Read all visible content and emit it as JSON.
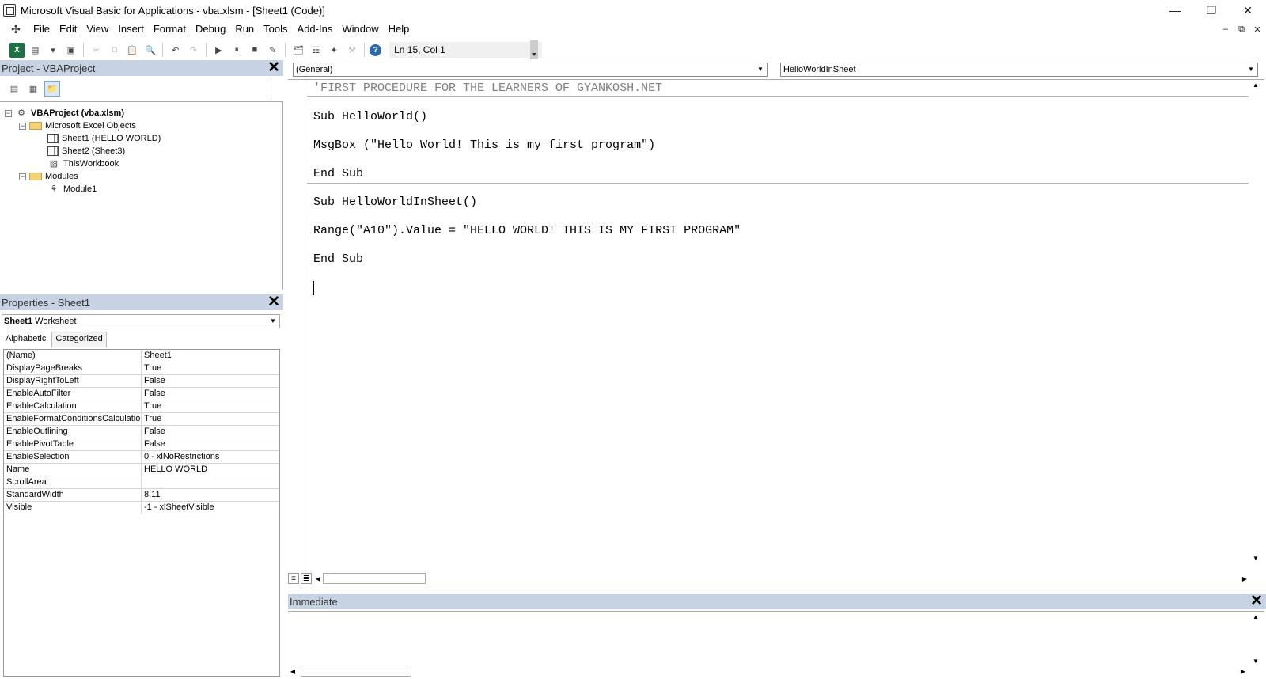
{
  "window": {
    "title": "Microsoft Visual Basic for Applications - vba.xlsm - [Sheet1 (Code)]",
    "minimize": "—",
    "restore": "❐",
    "close": "✕"
  },
  "menu": {
    "items": [
      "File",
      "Edit",
      "View",
      "Insert",
      "Format",
      "Debug",
      "Run",
      "Tools",
      "Add-Ins",
      "Window",
      "Help"
    ],
    "mdi": [
      "–",
      "⧉",
      "✕"
    ]
  },
  "toolbar": {
    "status": "Ln 15, Col 1"
  },
  "project": {
    "title": "Project - VBAProject",
    "close": "✕",
    "tree": [
      {
        "label": "VBAProject (vba.xlsm)",
        "bold": true
      },
      {
        "label": "Microsoft Excel Objects"
      },
      {
        "label": "Sheet1 (HELLO WORLD)"
      },
      {
        "label": "Sheet2 (Sheet3)"
      },
      {
        "label": "ThisWorkbook"
      },
      {
        "label": "Modules"
      },
      {
        "label": "Module1"
      }
    ]
  },
  "properties": {
    "title": "Properties - Sheet1",
    "close": "✕",
    "object_name": "Sheet1",
    "object_type": "Worksheet",
    "tabs": [
      "Alphabetic",
      "Categorized"
    ],
    "rows": [
      [
        "(Name)",
        "Sheet1"
      ],
      [
        "DisplayPageBreaks",
        "True"
      ],
      [
        "DisplayRightToLeft",
        "False"
      ],
      [
        "EnableAutoFilter",
        "False"
      ],
      [
        "EnableCalculation",
        "True"
      ],
      [
        "EnableFormatConditionsCalculation",
        "True"
      ],
      [
        "EnableOutlining",
        "False"
      ],
      [
        "EnablePivotTable",
        "False"
      ],
      [
        "EnableSelection",
        "0 - xlNoRestrictions"
      ],
      [
        "Name",
        "HELLO WORLD"
      ],
      [
        "ScrollArea",
        ""
      ],
      [
        "StandardWidth",
        "8.11"
      ],
      [
        "Visible",
        "-1 - xlSheetVisible"
      ]
    ]
  },
  "code": {
    "object_combo": "(General)",
    "proc_combo": "HelloWorldInSheet",
    "lines": [
      "'FIRST PROCEDURE FOR THE LEARNERS OF GYANKOSH.NET",
      "Sub HelloWorld()",
      "MsgBox (\"Hello World! This is my first program\")",
      "End Sub",
      "Sub HelloWorldInSheet()",
      "Range(\"A10\").Value = \"HELLO WORLD! THIS IS MY FIRST PROGRAM\"",
      "End Sub"
    ]
  },
  "immediate": {
    "title": "Immediate",
    "close": "✕"
  }
}
